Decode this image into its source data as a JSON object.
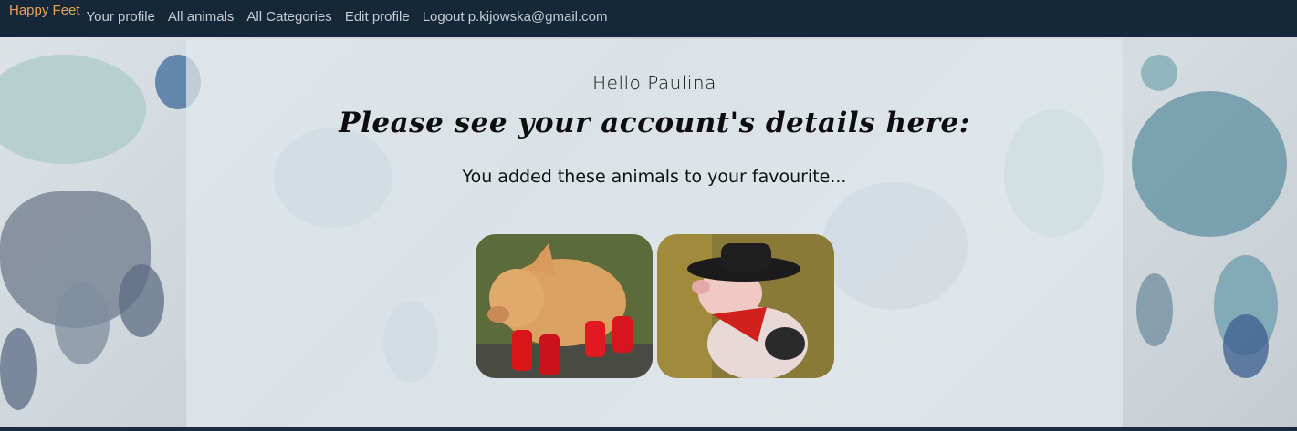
{
  "nav": {
    "brand": "Happy Feet",
    "links": [
      "Your profile",
      "All animals",
      "All Categories",
      "Edit profile",
      "Logout p.kijowska@gmail.com"
    ]
  },
  "content": {
    "greeting": "Hello Paulina",
    "heading": "Please see your account's details here:",
    "favourites_label": "You added these animals to your favourite...",
    "favourites": [
      {
        "icon": "pig-in-red-boots-photo"
      },
      {
        "icon": "pig-in-cowboy-hat-photo"
      }
    ]
  },
  "colors": {
    "nav_bg": "#14283a",
    "brand": "#f0a04b",
    "nav_link": "#c6ccd2"
  }
}
